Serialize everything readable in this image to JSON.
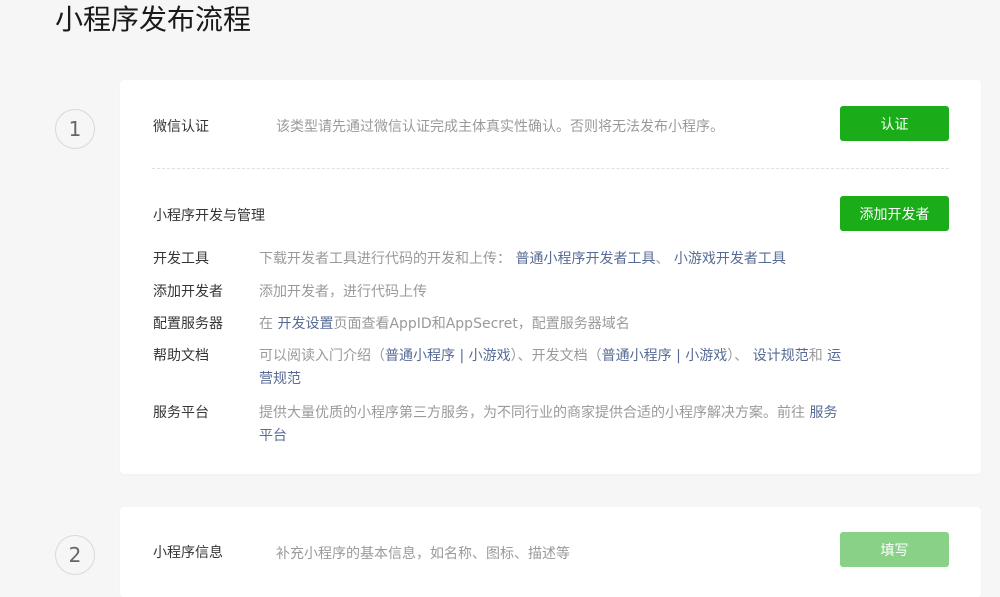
{
  "page": {
    "title": "小程序发布流程"
  },
  "step1": {
    "number": "1",
    "verify": {
      "label": "微信认证",
      "desc": "该类型请先通过微信认证完成主体真实性确认。否则将无法发布小程序。",
      "button": "认证"
    },
    "dev": {
      "title": "小程序开发与管理",
      "button": "添加开发者",
      "items": {
        "tools": {
          "label": "开发工具",
          "text": "下载开发者工具进行代码的开发和上传：",
          "link1": "普通小程序开发者工具",
          "sep": "、",
          "link2": "小游戏开发者工具"
        },
        "add_dev": {
          "label": "添加开发者",
          "text": "添加开发者，进行代码上传"
        },
        "server": {
          "label": "配置服务器",
          "pre": "在",
          "link": "开发设置",
          "post": "页面查看AppID和AppSecret，配置服务器域名"
        },
        "docs": {
          "label": "帮助文档",
          "t1": "可以阅读入门介绍（",
          "l1": "普通小程序",
          "s1": "|",
          "l2": "小游戏",
          "t2": "）、开发文档（",
          "l3": "普通小程序",
          "s2": "|",
          "l4": "小游戏",
          "t3": "）、",
          "l5": "设计规范",
          "t4": "和",
          "l6": "运营规范"
        },
        "service": {
          "label": "服务平台",
          "text": "提供大量优质的小程序第三方服务，为不同行业的商家提供合适的小程序解决方案。前往",
          "link": "服务平台"
        }
      }
    }
  },
  "step2": {
    "number": "2",
    "label": "小程序信息",
    "desc": "补充小程序的基本信息，如名称、图标、描述等",
    "button": "填写"
  },
  "colors": {
    "primary_green": "#1aad19",
    "disabled_green": "#88d187",
    "link_blue": "#576b95",
    "muted_text": "#9a9a9a"
  }
}
